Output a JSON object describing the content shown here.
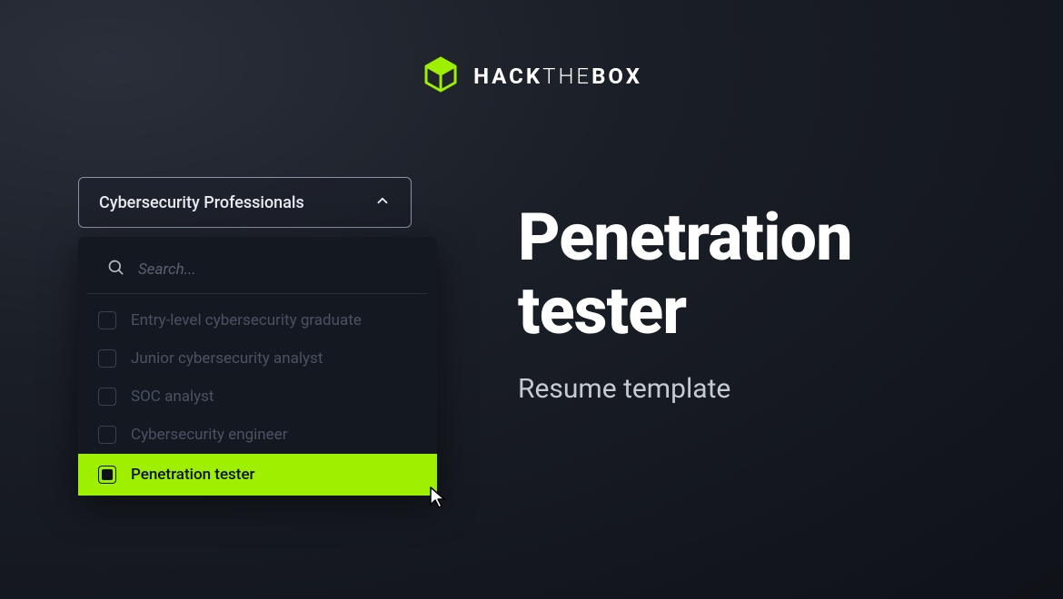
{
  "logo": {
    "brand_hack": "HACK",
    "brand_the": "THE",
    "brand_box": "BOX",
    "accent_color": "#9fef00"
  },
  "dropdown": {
    "header_label": "Cybersecurity Professionals",
    "search_placeholder": "Search...",
    "items": [
      {
        "label": "Entry-level cybersecurity graduate",
        "selected": false
      },
      {
        "label": "Junior cybersecurity analyst",
        "selected": false
      },
      {
        "label": "SOC analyst",
        "selected": false
      },
      {
        "label": "Cybersecurity engineer",
        "selected": false
      },
      {
        "label": "Penetration tester",
        "selected": true
      }
    ]
  },
  "heading": {
    "title_line1": "Penetration",
    "title_line2": "tester",
    "subtitle": "Resume template"
  }
}
